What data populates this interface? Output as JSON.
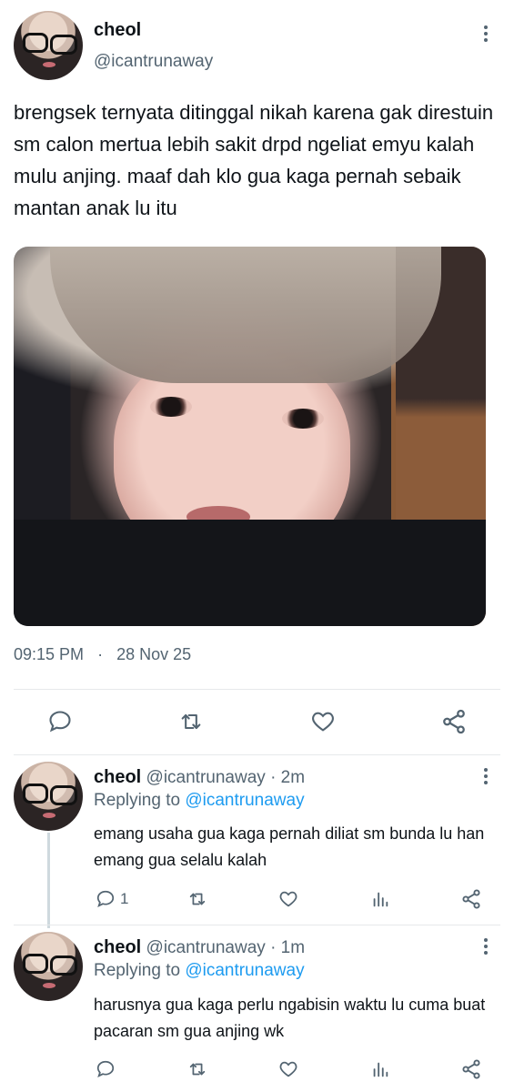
{
  "main_tweet": {
    "author_name": "cheol",
    "author_handle": "@icantrunaway",
    "text": "brengsek ternyata ditinggal nikah karena gak direstuin sm calon mertua lebih sakit drpd ngeliat emyu kalah mulu anjing. maaf dah klo gua kaga pernah sebaik mantan anak lu itu",
    "time": "09:15 PM",
    "separator": "·",
    "date": "28 Nov 25",
    "actions": [
      "comment-icon",
      "retweet-icon",
      "like-icon",
      "share-icon"
    ]
  },
  "replies": [
    {
      "author_name": "cheol",
      "author_handle": "@icantrunaway",
      "age": "· 2m",
      "replying_prefix": "Replying to",
      "replying_to": "@icantrunaway",
      "text": "emang usaha gua kaga pernah diliat sm bunda lu han emang gua selalu kalah",
      "reply_count": "1"
    },
    {
      "author_name": "cheol",
      "author_handle": "@icantrunaway",
      "age": "· 1m",
      "replying_prefix": "Replying to",
      "replying_to": "@icantrunaway",
      "text": "harusnya gua kaga perlu ngabisin waktu lu cuma buat pacaran sm gua anjing wk",
      "reply_count": ""
    }
  ],
  "colors": {
    "text": "#0f1419",
    "secondary": "#536471",
    "link": "#1d9bf0",
    "divider": "#e6e9eb"
  }
}
